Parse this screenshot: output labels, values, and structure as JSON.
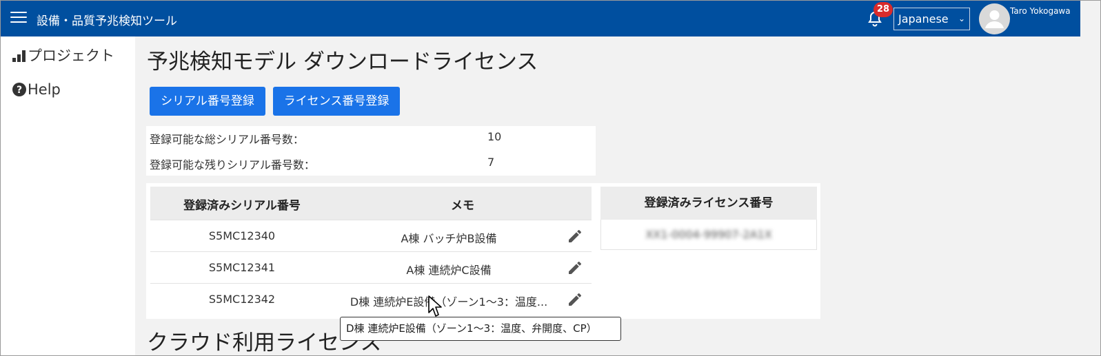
{
  "header": {
    "app_title": "設備・品質予兆検知ツール",
    "notification_count": "28",
    "language": "Japanese",
    "user_name": "Taro Yokogawa",
    "menu_icon": "hamburger-icon",
    "bell_icon": "bell-icon",
    "avatar_icon": "person-icon"
  },
  "sidebar": {
    "items": [
      {
        "label": "プロジェクト",
        "icon": "bar-chart-icon"
      },
      {
        "label": "Help",
        "icon": "help-circle-icon"
      }
    ]
  },
  "main": {
    "page_title": "予兆検知モデル ダウンロードライセンス",
    "buttons": {
      "serial_register": "シリアル番号登録",
      "license_register": "ライセンス番号登録"
    },
    "counts": [
      {
        "label": "登録可能な総シリアル番号数：",
        "value": "10"
      },
      {
        "label": "登録可能な残りシリアル番号数：",
        "value": "7"
      }
    ],
    "serial_table": {
      "headers": [
        "登録済みシリアル番号",
        "メモ"
      ],
      "rows": [
        {
          "serial": "S5MC12340",
          "memo": "A棟 バッチ炉B設備"
        },
        {
          "serial": "S5MC12341",
          "memo": "A棟 連続炉C設備"
        },
        {
          "serial": "S5MC12342",
          "memo": "D棟 連続炉E設備（ゾーン1～3：温度..."
        }
      ]
    },
    "license_table": {
      "header": "登録済みライセンス番号",
      "rows": [
        {
          "license": "XX1-0004-99907-2A1X"
        }
      ]
    },
    "tooltip": "D棟 連続炉E設備（ゾーン1～3：温度、弁開度、CP）",
    "section2_title": "クラウド利用ライセンス"
  },
  "colors": {
    "header_bg": "#004f9f",
    "button_bg": "#1a73e8",
    "badge_bg": "#d92b2b",
    "page_bg": "#f2f2f2"
  }
}
